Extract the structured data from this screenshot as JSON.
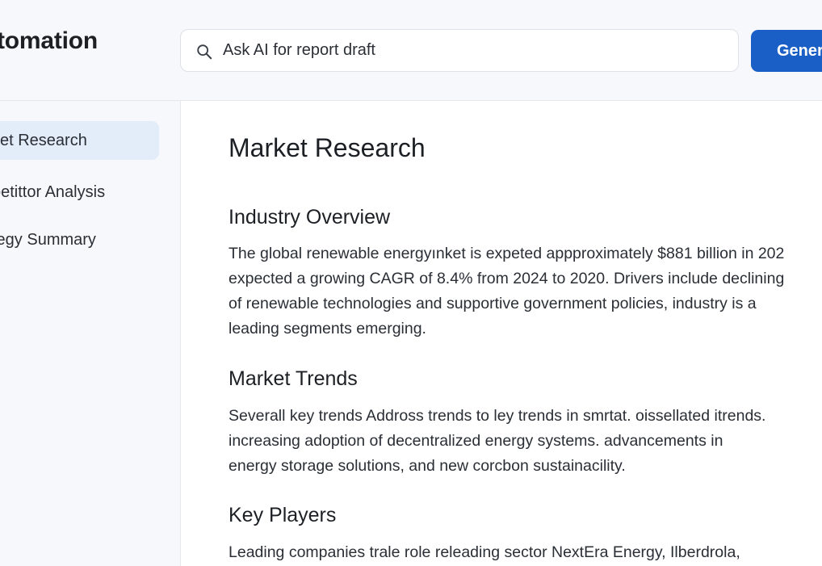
{
  "header": {
    "app_title": "tomation",
    "search": {
      "placeholder": "Ask AI for report draft",
      "value": ""
    },
    "generate_label": "Gener"
  },
  "sidebar": {
    "items": [
      {
        "label": "ket Research",
        "active": true
      },
      {
        "label": "petittor Analysis",
        "active": false
      },
      {
        "label": "tegy Summary",
        "active": false
      }
    ]
  },
  "main": {
    "title": "Market Research",
    "sections": [
      {
        "heading": "Industry Overview",
        "lines": [
          "The global renewable energyınket is expeted appproximately $881 billion in 202",
          "expected a growing CAGR of 8.4% from 2024 to 2020. Drivers include declining",
          "of renewable technologies and supportive government policies, industry is a",
          "leading segments emerging."
        ]
      },
      {
        "heading": "Market Trends",
        "lines": [
          "Severall key trends Addross trends to ley trends in smrtat. oissellated itrends.",
          "increasing adoption of decentralized energy systems. advancements in",
          "energy storage solutions, and new corcbon sustainacility."
        ]
      },
      {
        "heading": "Key Players",
        "lines": [
          "Leading companies trale role releading sector NextEra Energy, Ilberdrola,"
        ]
      }
    ]
  },
  "colors": {
    "accent": "#1a5fc6",
    "active_item_bg": "#e3ecf9",
    "chrome_bg": "#f7f8fb",
    "border": "#e6e8ee"
  },
  "icons": {
    "search": "search-icon"
  }
}
